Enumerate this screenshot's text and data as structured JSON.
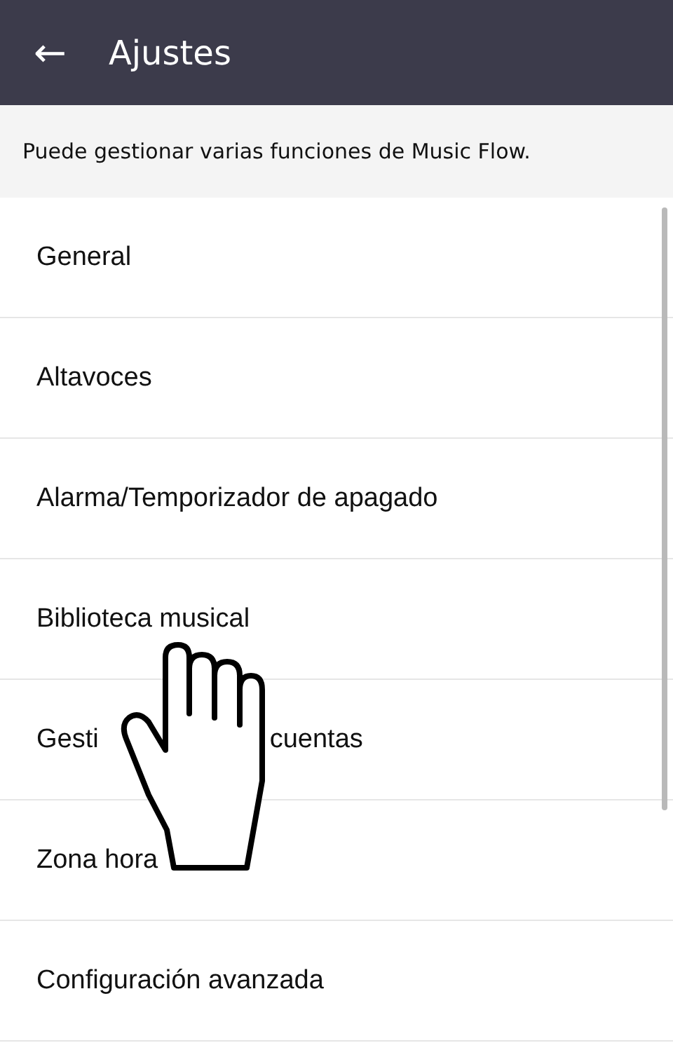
{
  "app_bar": {
    "back_icon": "←",
    "title": "Ajustes"
  },
  "description": "Puede gestionar varias funciones de Music Flow.",
  "items": [
    {
      "segments": [
        "General"
      ]
    },
    {
      "segments": [
        "Altavoces"
      ]
    },
    {
      "segments": [
        "Alarma/Temporizador de apagado"
      ]
    },
    {
      "segments": [
        "Biblioteca musical"
      ]
    },
    {
      "segments": [
        "Gesti",
        "cuentas"
      ]
    },
    {
      "segments": [
        "Zona hora"
      ]
    },
    {
      "segments": [
        "Configuración avanzada"
      ]
    }
  ]
}
